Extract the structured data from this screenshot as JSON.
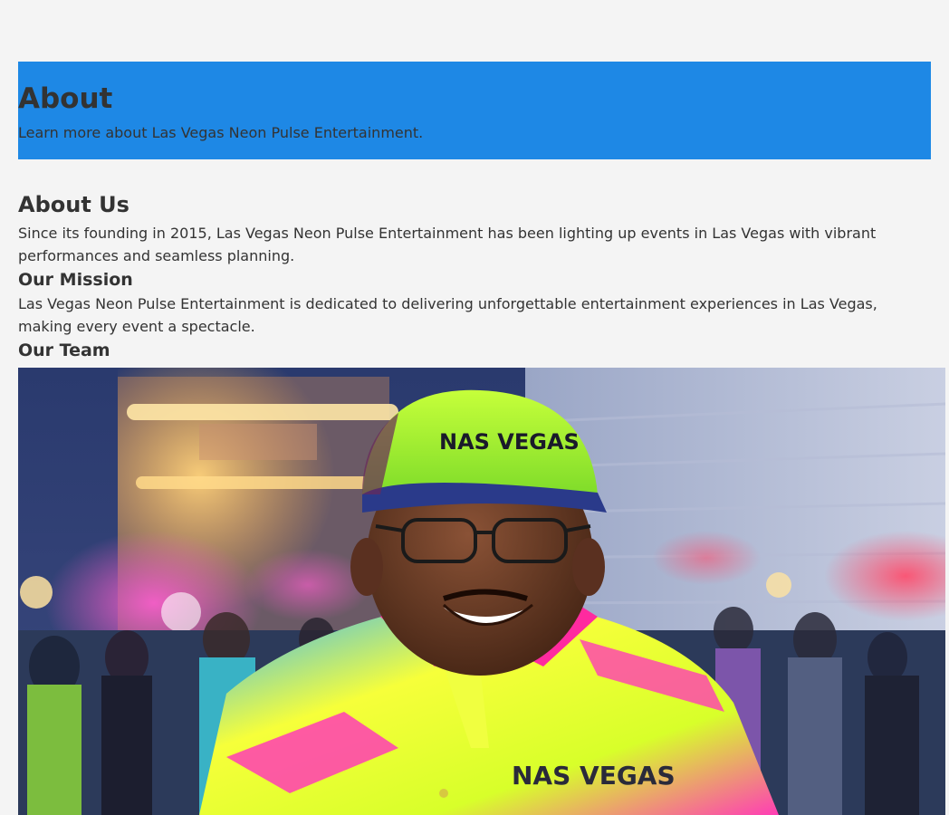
{
  "hero": {
    "title": "About",
    "subtitle": "Learn more about Las Vegas Neon Pulse Entertainment."
  },
  "about": {
    "heading": "About Us",
    "text": "Since its founding in 2015, Las Vegas Neon Pulse Entertainment has been lighting up events in Las Vegas with vibrant performances and seamless planning."
  },
  "mission": {
    "heading": "Our Mission",
    "text": "Las Vegas Neon Pulse Entertainment is dedicated to delivering unforgettable entertainment experiences in Las Vegas, making every event a spectacle."
  },
  "team": {
    "heading": "Our Team",
    "cap_text": "NAS VEGAS",
    "shirt_text": "NAS VEGAS"
  },
  "colors": {
    "hero_bg": "#1e88e5",
    "page_bg": "#f4f4f4",
    "text": "#333333"
  }
}
